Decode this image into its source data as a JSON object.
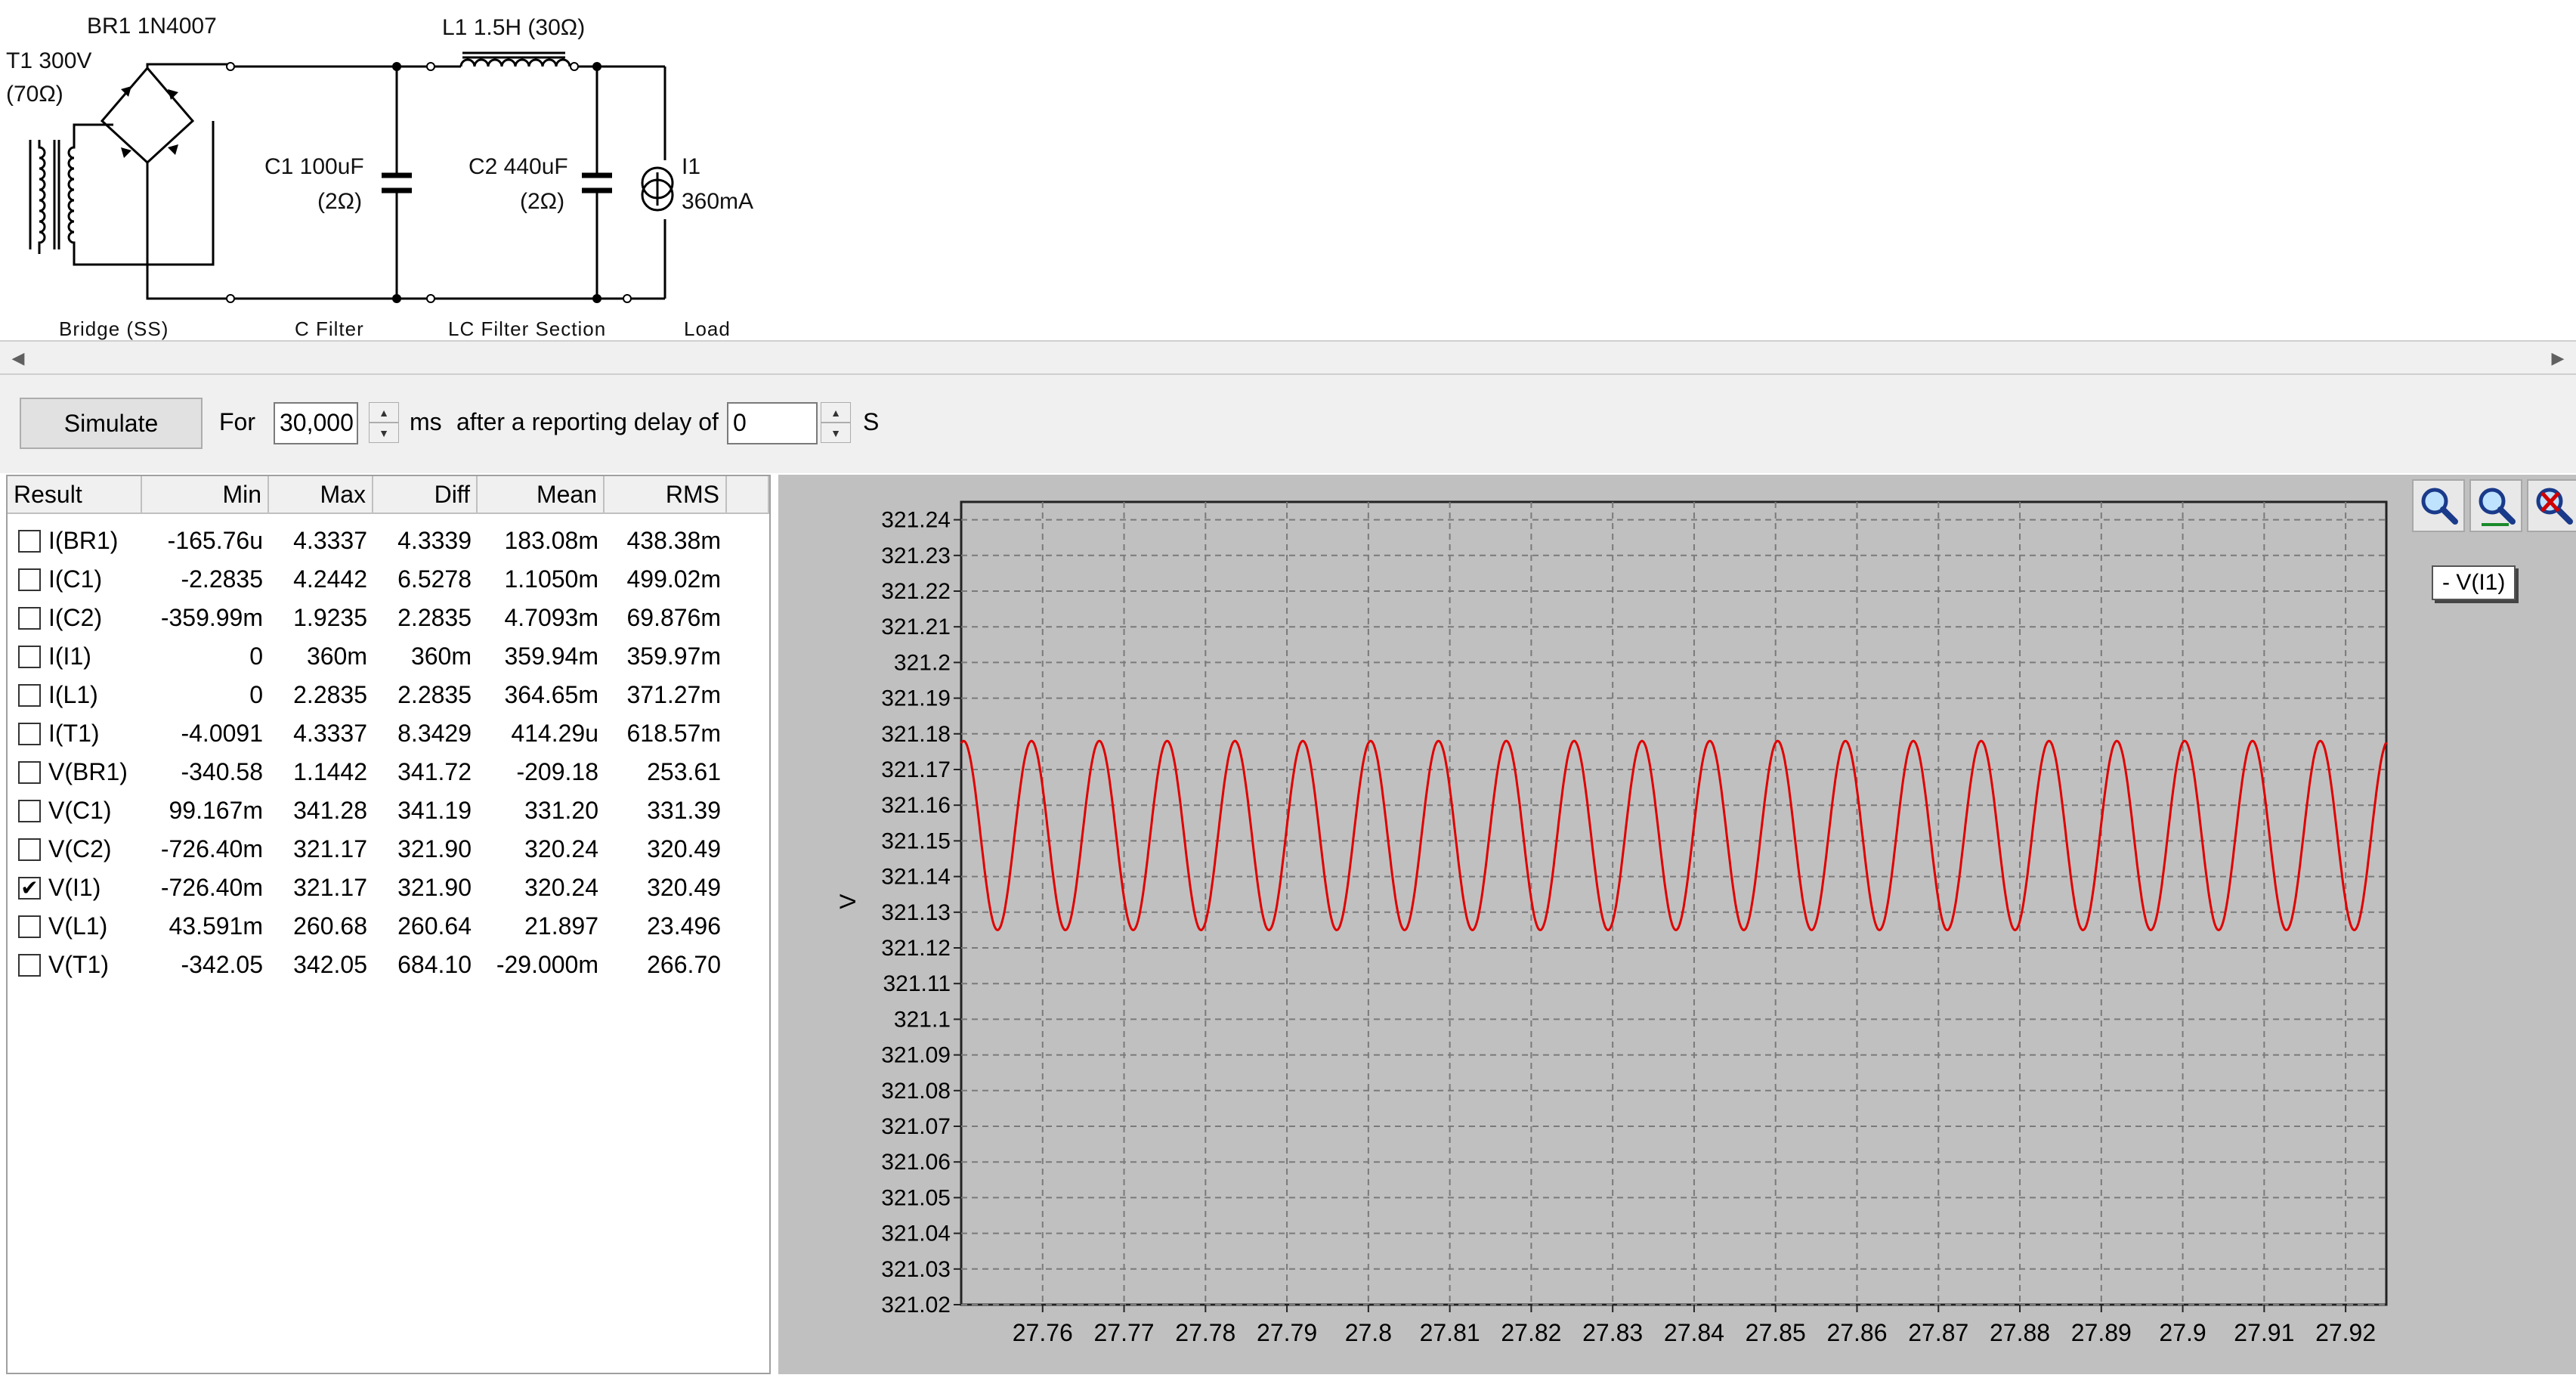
{
  "schematic": {
    "br1_label": "BR1 1N4007",
    "l1_label": "L1 1.5H (30Ω)",
    "t1_label_line1": "T1 300V",
    "t1_label_line2": "(70Ω)",
    "c1_label_line1": "C1 100uF",
    "c1_label_line2": "(2Ω)",
    "c2_label_line1": "C2 440uF",
    "c2_label_line2": "(2Ω)",
    "i1_label_line1": "I1",
    "i1_label_line2": "360mA",
    "sections": [
      "Bridge (SS)",
      "C Filter",
      "LC Filter Section",
      "Load"
    ]
  },
  "toolbar": {
    "simulate_label": "Simulate",
    "for_label": "For",
    "duration_value": "30,000",
    "ms_label": "ms",
    "delay_label": "after a reporting delay of",
    "delay_value": "0",
    "s_label": "S"
  },
  "results": {
    "columns": [
      "Result",
      "Min",
      "Max",
      "Diff",
      "Mean",
      "RMS"
    ],
    "rows": [
      {
        "name": "I(BR1)",
        "checked": false,
        "min": "-165.76u",
        "max": "4.3337",
        "diff": "4.3339",
        "mean": "183.08m",
        "rms": "438.38m"
      },
      {
        "name": "I(C1)",
        "checked": false,
        "min": "-2.2835",
        "max": "4.2442",
        "diff": "6.5278",
        "mean": "1.1050m",
        "rms": "499.02m"
      },
      {
        "name": "I(C2)",
        "checked": false,
        "min": "-359.99m",
        "max": "1.9235",
        "diff": "2.2835",
        "mean": "4.7093m",
        "rms": "69.876m"
      },
      {
        "name": "I(I1)",
        "checked": false,
        "min": "0",
        "max": "360m",
        "diff": "360m",
        "mean": "359.94m",
        "rms": "359.97m"
      },
      {
        "name": "I(L1)",
        "checked": false,
        "min": "0",
        "max": "2.2835",
        "diff": "2.2835",
        "mean": "364.65m",
        "rms": "371.27m"
      },
      {
        "name": "I(T1)",
        "checked": false,
        "min": "-4.0091",
        "max": "4.3337",
        "diff": "8.3429",
        "mean": "414.29u",
        "rms": "618.57m"
      },
      {
        "name": "V(BR1)",
        "checked": false,
        "min": "-340.58",
        "max": "1.1442",
        "diff": "341.72",
        "mean": "-209.18",
        "rms": "253.61"
      },
      {
        "name": "V(C1)",
        "checked": false,
        "min": "99.167m",
        "max": "341.28",
        "diff": "341.19",
        "mean": "331.20",
        "rms": "331.39"
      },
      {
        "name": "V(C2)",
        "checked": false,
        "min": "-726.40m",
        "max": "321.17",
        "diff": "321.90",
        "mean": "320.24",
        "rms": "320.49"
      },
      {
        "name": "V(I1)",
        "checked": true,
        "min": "-726.40m",
        "max": "321.17",
        "diff": "321.90",
        "mean": "320.24",
        "rms": "320.49"
      },
      {
        "name": "V(L1)",
        "checked": false,
        "min": "43.591m",
        "max": "260.68",
        "diff": "260.64",
        "mean": "21.897",
        "rms": "23.496"
      },
      {
        "name": "V(T1)",
        "checked": false,
        "min": "-342.05",
        "max": "342.05",
        "diff": "684.10",
        "mean": "-29.000m",
        "rms": "266.70"
      }
    ]
  },
  "legend_label": "- V(I1)",
  "colors": {
    "trace": "#e00000",
    "plot_bg": "#c0c0c0",
    "panel_bg": "#f0f0f0"
  },
  "icons": [
    "zoom-in-icon",
    "zoom-out-icon",
    "zoom-reset-icon",
    "checkmark-icon",
    "arrow-left-icon",
    "arrow-right-icon"
  ],
  "chart_data": {
    "type": "line",
    "ylabel": "V",
    "xlabel": "",
    "ylim": [
      321.02,
      321.245
    ],
    "xlim": [
      27.75,
      27.925
    ],
    "x_ticks": [
      "27.76",
      "27.77",
      "27.78",
      "27.79",
      "27.8",
      "27.81",
      "27.82",
      "27.83",
      "27.84",
      "27.85",
      "27.86",
      "27.87",
      "27.88",
      "27.89",
      "27.9",
      "27.91",
      "27.92"
    ],
    "y_ticks": [
      "321.24",
      "321.23",
      "321.22",
      "321.21",
      "321.2",
      "321.19",
      "321.18",
      "321.17",
      "321.16",
      "321.15",
      "321.14",
      "321.13",
      "321.12",
      "321.11",
      "321.1",
      "321.09",
      "321.08",
      "321.07",
      "321.06",
      "321.05",
      "321.04",
      "321.03",
      "321.02"
    ],
    "grid": true,
    "series": [
      {
        "name": "V(I1)",
        "color": "#e00000",
        "waveform": "periodic ripple",
        "period": 0.00833,
        "max": 321.178,
        "min": 321.125,
        "first_peak_x": 27.7503
      }
    ]
  }
}
